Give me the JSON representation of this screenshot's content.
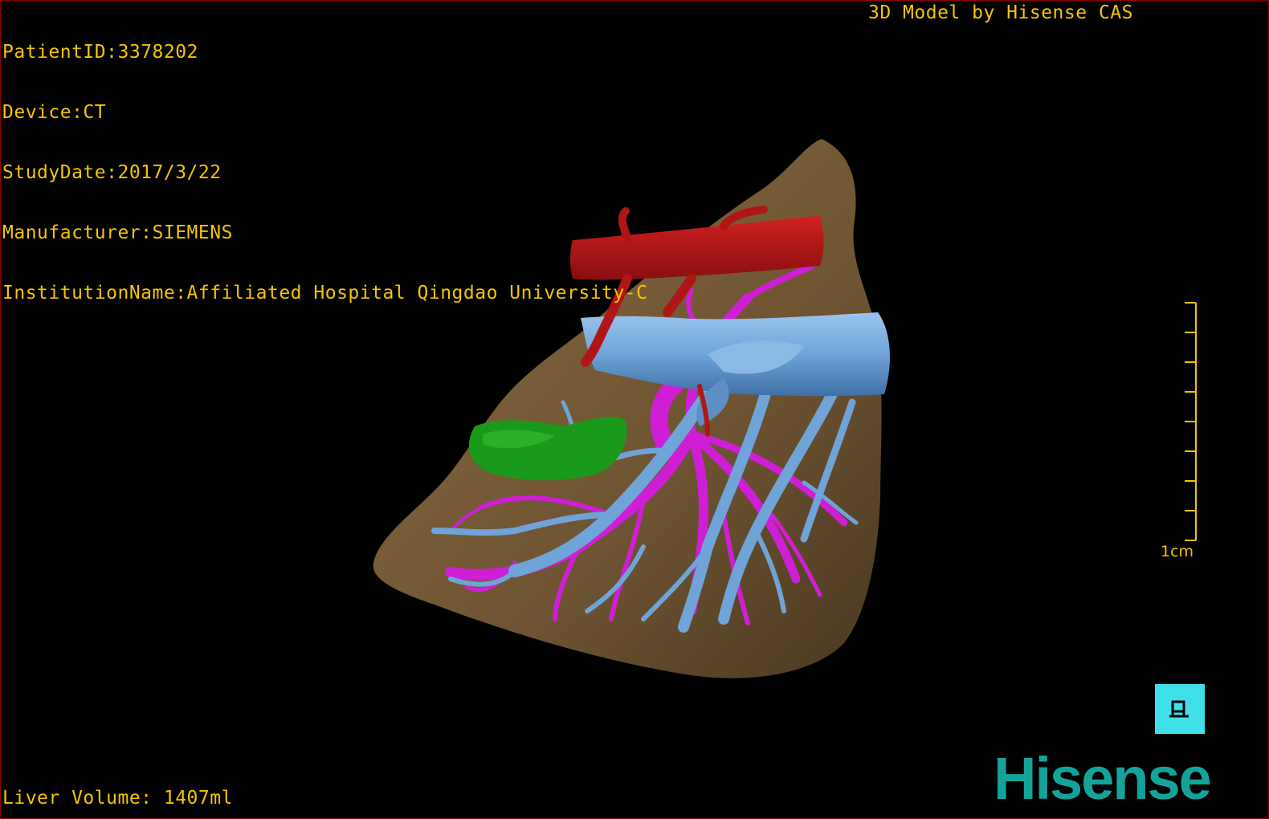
{
  "header": {
    "patient_id": "PatientID:3378202",
    "device": "Device:CT",
    "study_date": "StudyDate:2017/3/22",
    "manufacturer": "Manufacturer:SIEMENS",
    "institution": "InstitutionName:Affiliated Hospital Qingdao University-C",
    "brand_title": "3D Model by Hisense CAS"
  },
  "footer": {
    "liver_volume": "Liver Volume: 1407ml",
    "logo": "Hisense"
  },
  "scale": {
    "label": "1cm"
  },
  "colors": {
    "overlay_text": "#f5c400",
    "liver": "#6e5432",
    "artery": "#b01616",
    "vein": "#6fa4d8",
    "portal": "#d01ed6",
    "gallbladder": "#1a9a1a",
    "orient_button": "#3fe0ea",
    "logo": "#14a39a"
  },
  "icons": {
    "orientation": "person-orientation-icon"
  }
}
